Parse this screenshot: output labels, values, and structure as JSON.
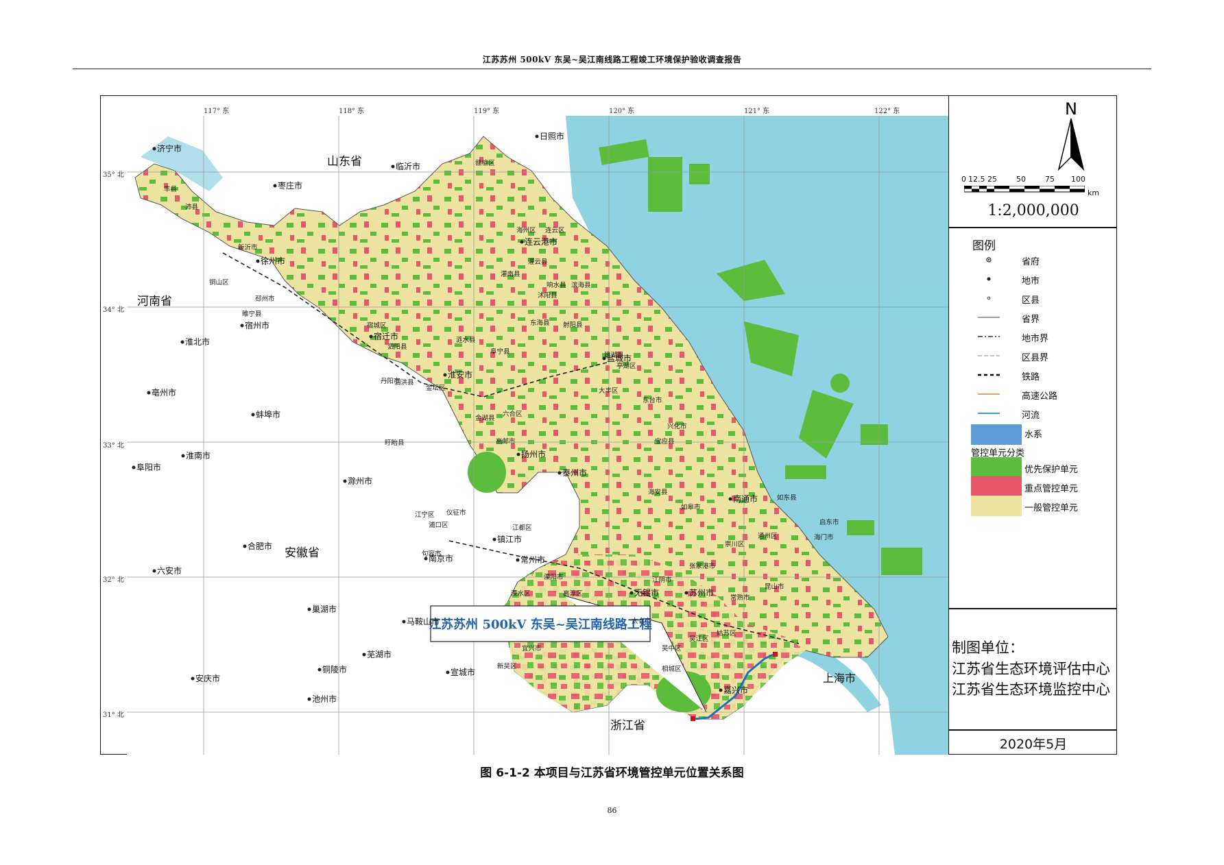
{
  "header": {
    "title": "江苏苏州 500kV 东吴~吴江南线路工程竣工环境保护验收调查报告"
  },
  "longitude_labels": [
    "117° 东",
    "118° 东",
    "119° 东",
    "120° 东",
    "121° 东",
    "122° 东"
  ],
  "latitude_labels": [
    "35° 北",
    "34° 北",
    "33° 北",
    "32° 北",
    "31° 北"
  ],
  "map": {
    "provinces": [
      "山东省",
      "河南省",
      "安徽省",
      "浙江省",
      "上海市"
    ],
    "cities": [
      "济宁市",
      "日照市",
      "临沂市",
      "枣庄市",
      "连云港市",
      "徐州市",
      "宿州市",
      "淮北市",
      "宿迁市",
      "淮安市",
      "盐城市",
      "亳州市",
      "蚌埠市",
      "扬州市",
      "泰州市",
      "淮南市",
      "阜阳市",
      "滁州市",
      "南通市",
      "合肥市",
      "六安市",
      "南京市",
      "镇江市",
      "常州市",
      "无锡市",
      "苏州市",
      "马鞍山市",
      "巢湖市",
      "芜湖市",
      "宣城市",
      "铜陵市",
      "安庆市",
      "池州市",
      "嘉兴市"
    ],
    "districts": [
      "赣榆区",
      "海州区",
      "连云区",
      "灌云县",
      "灌南县",
      "响水县",
      "滨海县",
      "沭阳县",
      "东海县",
      "新沂市",
      "邳州市",
      "睢宁县",
      "丰县",
      "沛县",
      "铜山区",
      "宿城区",
      "泗阳县",
      "泗洪县",
      "涟水县",
      "阜宁县",
      "射阳县",
      "建湖县",
      "亭湖区",
      "大丰区",
      "东台市",
      "兴化市",
      "宝应县",
      "金湖县",
      "盱眙县",
      "高邮市",
      "江都区",
      "仪征市",
      "如皋市",
      "海安县",
      "如东县",
      "启东市",
      "海门市",
      "通州区",
      "崇川区",
      "张家港市",
      "江阴市",
      "常熟市",
      "太仓市",
      "昆山市",
      "吴江区",
      "吴中区",
      "相城区",
      "姑苏区",
      "新吴区",
      "宜兴市",
      "溧阳市",
      "高淳区",
      "溧水区",
      "江宁区",
      "句容市",
      "丹阳市",
      "金坛区",
      "六合区",
      "浦口区",
      "洪泽区",
      "清江浦区",
      "盐都区",
      "淮阴区"
    ],
    "callout": "江苏苏州 500kV 东吴~吴江南线路工程"
  },
  "scale": {
    "ticks": [
      "0",
      "12.5",
      "25",
      "50",
      "75",
      "100"
    ],
    "unit": "km",
    "ratio": "1:2,000,000"
  },
  "legend": {
    "title": "图例",
    "items": [
      {
        "label": "省府",
        "symbol": "dot-ring"
      },
      {
        "label": "地市",
        "symbol": "dot"
      },
      {
        "label": "区县",
        "symbol": "small-dot"
      },
      {
        "label": "省界",
        "symbol": "line-solid-thin"
      },
      {
        "label": "地市界",
        "symbol": "line-dash-dot"
      },
      {
        "label": "区县界",
        "symbol": "line-dash-light"
      },
      {
        "label": "铁路",
        "symbol": "line-dash-black"
      },
      {
        "label": "高速公路",
        "symbol": "line-orange"
      },
      {
        "label": "河流",
        "symbol": "line-blue"
      },
      {
        "label": "水系",
        "symbol": "fill-water"
      }
    ],
    "category_title": "管控单元分类",
    "categories": [
      {
        "label": "优先保护单元",
        "color": "#5cbd3c"
      },
      {
        "label": "重点管控单元",
        "color": "#e8566c"
      },
      {
        "label": "一般管控单元",
        "color": "#ede4a2"
      }
    ]
  },
  "maker": {
    "title": "制图单位：",
    "org1": "江苏省生态环境评估中心",
    "org2": "江苏省生态环境监控中心"
  },
  "date": "2020年5月",
  "caption": "图 6-1-2   本项目与江苏省环境管控单元位置关系图",
  "page_number": "86",
  "colors": {
    "sea": "#8fd2e2",
    "land_outside": "#ffffff",
    "priority": "#5cbd3c",
    "key": "#e8566c",
    "general": "#ede4a2",
    "line_route": "#1f6fc0"
  }
}
